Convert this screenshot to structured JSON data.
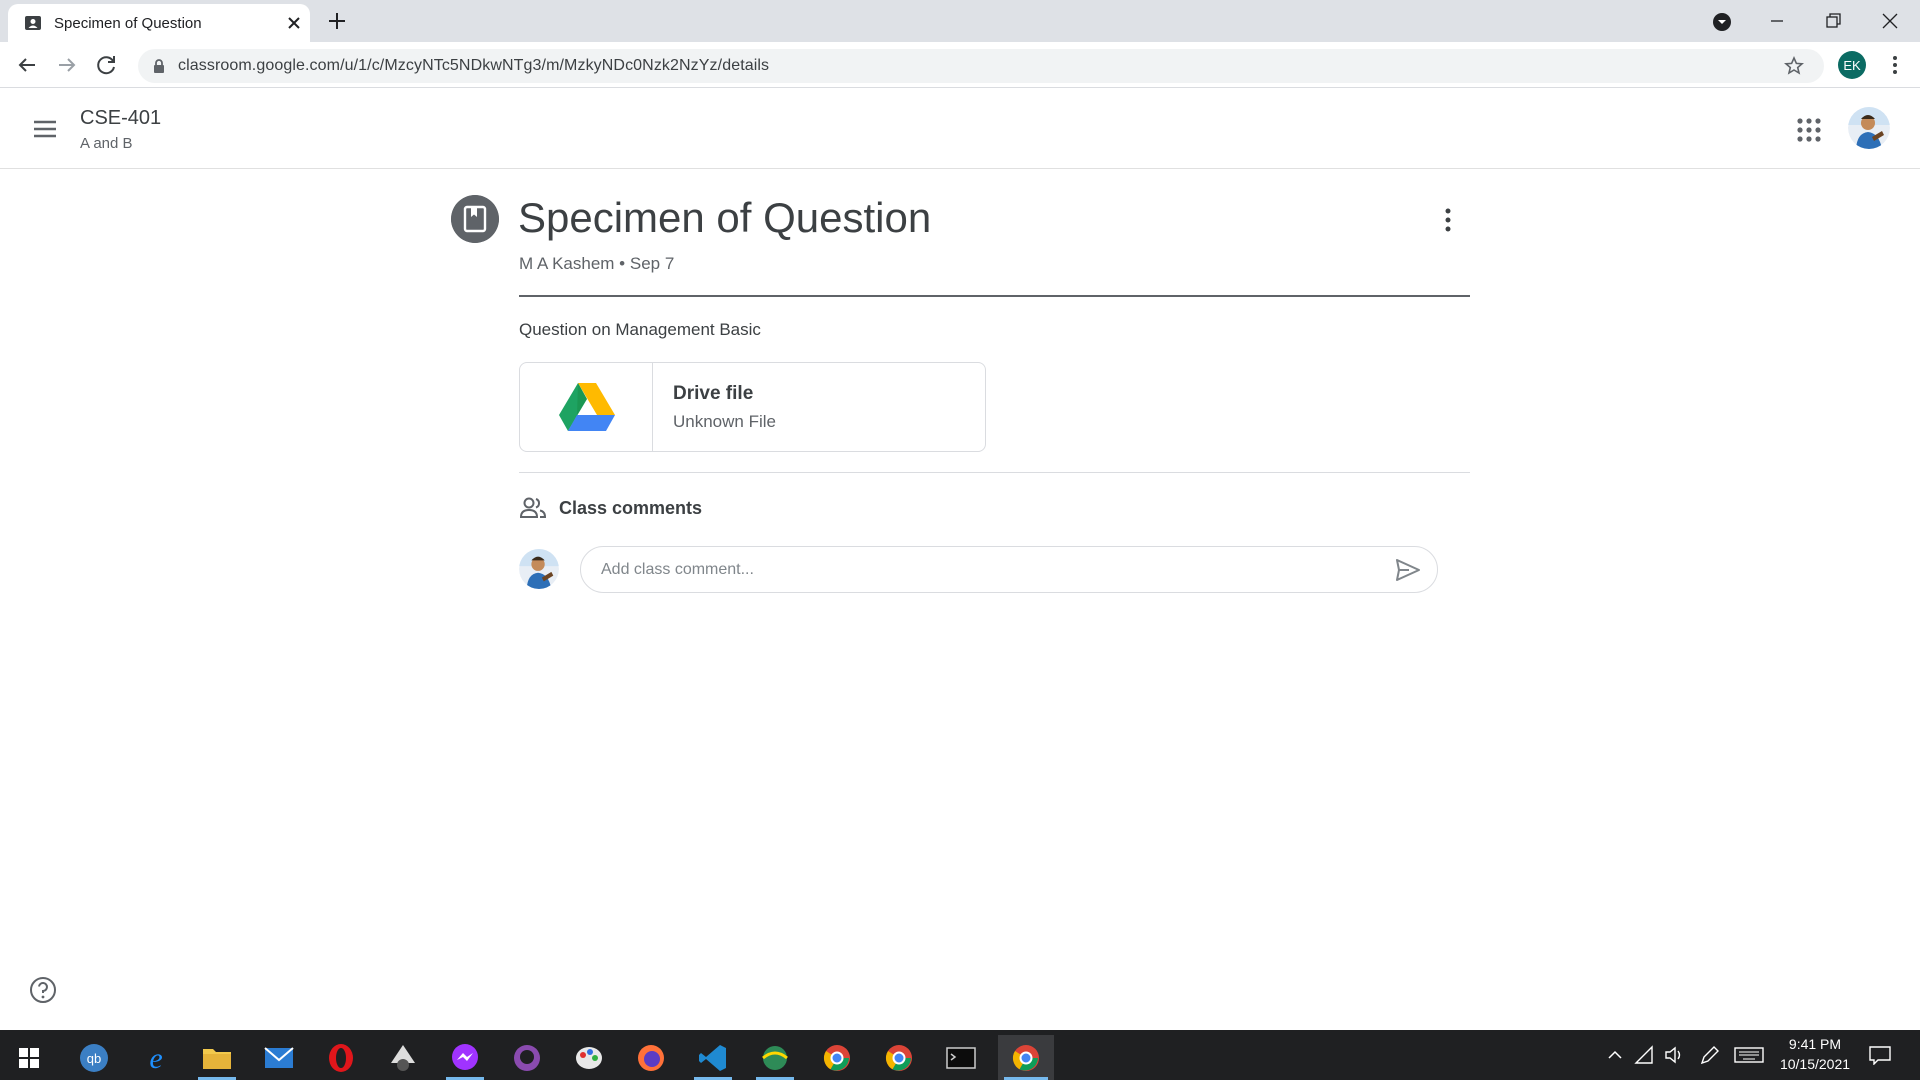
{
  "browser": {
    "tab_title": "Specimen of Question",
    "url": "classroom.google.com/u/1/c/MzcyNTc5NDkwNTg3/m/MzkyNDc0Nzk2NzYz/details",
    "profile_initials": "EK"
  },
  "header": {
    "class_name": "CSE-401",
    "class_section": "A and B"
  },
  "post": {
    "title": "Specimen of Question",
    "author": "M A Kashem",
    "separator": "•",
    "date": "Sep 7",
    "description": "Question on Management Basic",
    "attachment": {
      "title": "Drive file",
      "subtitle": "Unknown File",
      "icon": "google-drive-icon"
    }
  },
  "comments": {
    "label": "Class comments",
    "placeholder": "Add class comment..."
  },
  "taskbar": {
    "time": "9:41 PM",
    "date": "10/15/2021",
    "apps": [
      "windows-start",
      "qbittorrent",
      "edge",
      "file-explorer",
      "mail",
      "opera",
      "inkscape",
      "messenger",
      "github-desktop",
      "paint",
      "firefox",
      "vscode",
      "maps",
      "chrome-profile",
      "chrome",
      "terminal",
      "chrome-ek"
    ]
  },
  "colors": {
    "drive_green": "#1ea362",
    "drive_blue": "#4285f4",
    "drive_yellow": "#ffba00",
    "accent_grey": "#5f6368",
    "taskbar": "#1f2022"
  }
}
